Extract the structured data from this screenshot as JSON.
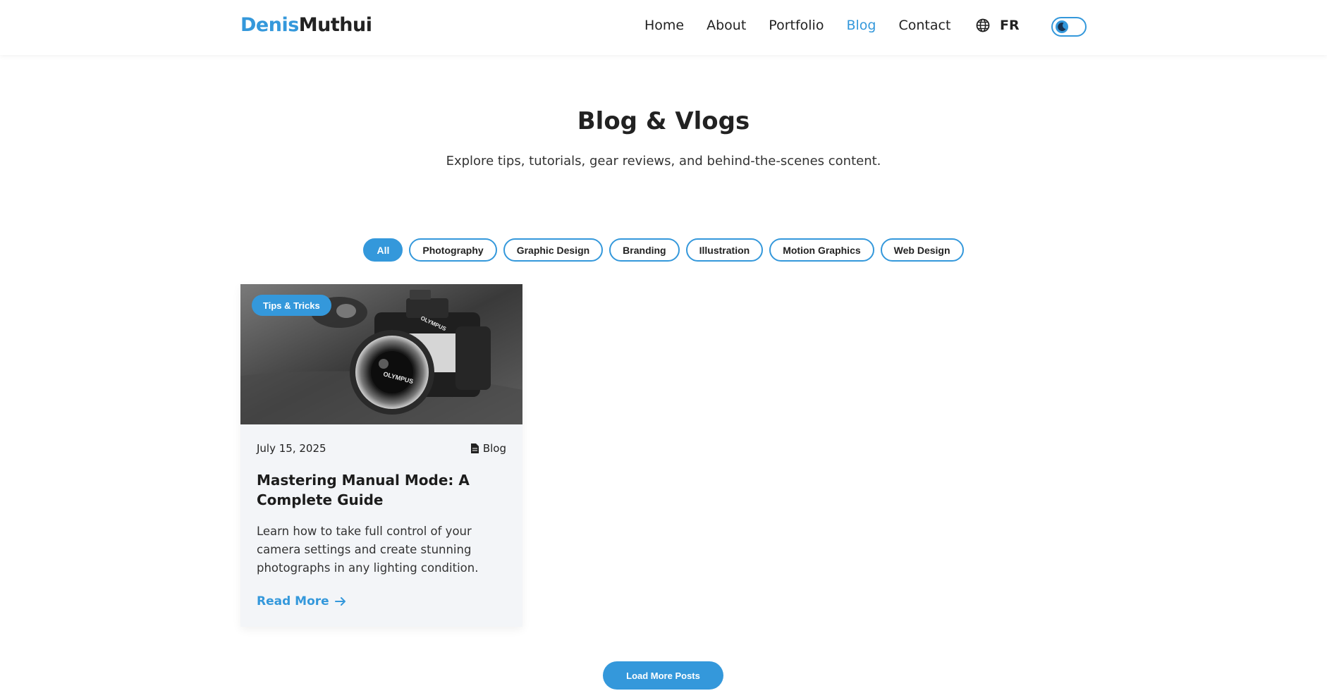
{
  "brand": {
    "first": "Denis",
    "last": "Muthui",
    "accent": "#3498db"
  },
  "nav": {
    "items": [
      {
        "label": "Home"
      },
      {
        "label": "About"
      },
      {
        "label": "Portfolio"
      },
      {
        "label": "Blog",
        "active": true
      },
      {
        "label": "Contact"
      }
    ],
    "language": "FR",
    "language_icon": "globe-icon",
    "theme_toggle_icon": "moon-icon"
  },
  "hero": {
    "title": "Blog & Vlogs",
    "subtitle": "Explore tips, tutorials, gear reviews, and behind-the-scenes content."
  },
  "filters": [
    {
      "label": "All",
      "active": true
    },
    {
      "label": "Photography"
    },
    {
      "label": "Graphic Design"
    },
    {
      "label": "Branding"
    },
    {
      "label": "Illustration"
    },
    {
      "label": "Motion Graphics"
    },
    {
      "label": "Web Design"
    }
  ],
  "posts": [
    {
      "tag": "Tips & Tricks",
      "date": "July 15, 2025",
      "type": "Blog",
      "type_icon": "file-icon",
      "title": "Mastering Manual Mode: A Complete Guide",
      "excerpt": "Learn how to take full control of your camera settings and create stunning photographs in any lighting condition.",
      "read_more": "Read More",
      "image_alt": "camera-photo",
      "camera_brand": "OLYMPUS"
    }
  ],
  "load_more": "Load More Posts"
}
